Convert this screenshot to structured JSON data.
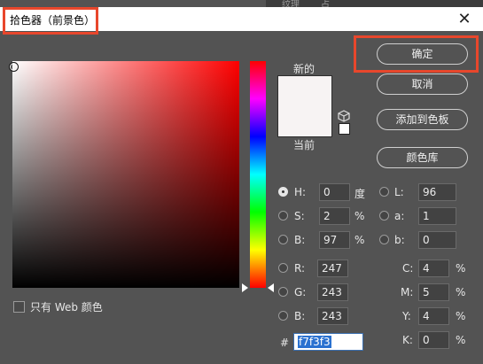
{
  "window": {
    "title": "拾色器（前景色）",
    "close_glyph": "✕"
  },
  "background_app": {
    "tab_text": "纹理",
    "tab_text2": "占"
  },
  "swatch": {
    "new_label": "新的",
    "current_label": "当前",
    "color": "#f7f3f3"
  },
  "buttons": {
    "ok": "确定",
    "cancel": "取消",
    "add_to_swatches": "添加到色板",
    "color_libraries": "颜色库"
  },
  "fields": {
    "h": {
      "label": "H:",
      "value": "0",
      "unit": "度"
    },
    "s": {
      "label": "S:",
      "value": "2",
      "unit": "%"
    },
    "b": {
      "label": "B:",
      "value": "97",
      "unit": "%"
    },
    "r": {
      "label": "R:",
      "value": "247"
    },
    "g": {
      "label": "G:",
      "value": "243"
    },
    "bl": {
      "label": "B:",
      "value": "243"
    },
    "l": {
      "label": "L:",
      "value": "96"
    },
    "a": {
      "label": "a:",
      "value": "1"
    },
    "lb": {
      "label": "b:",
      "value": "0"
    },
    "c": {
      "label": "C:",
      "value": "4",
      "unit": "%"
    },
    "m": {
      "label": "M:",
      "value": "5",
      "unit": "%"
    },
    "y": {
      "label": "Y:",
      "value": "4",
      "unit": "%"
    },
    "k": {
      "label": "K:",
      "value": "0",
      "unit": "%"
    },
    "hex": {
      "label": "#",
      "value": "f7f3f3"
    }
  },
  "web_only": {
    "label": "只有 Web 颜色"
  },
  "accent": "#e8472c"
}
